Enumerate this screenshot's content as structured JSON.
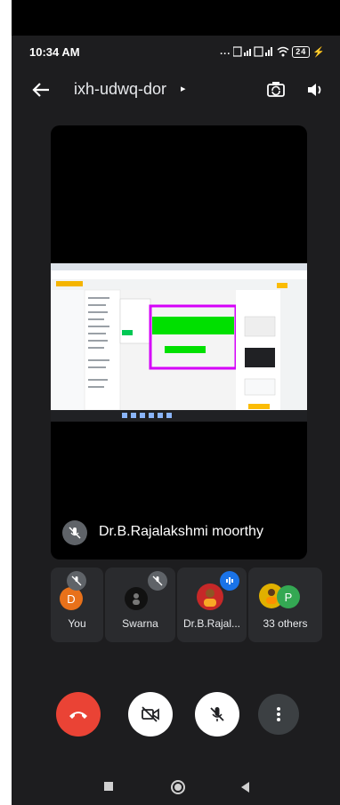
{
  "status": {
    "time": "10:34 AM",
    "signal": "...",
    "battery": "24"
  },
  "appbar": {
    "meeting_code": "ixh-udwq-dor",
    "caret": "▸"
  },
  "main_tile": {
    "speaker_name": "Dr.B.Rajalakshmi moorthy"
  },
  "participants": [
    {
      "label": "You",
      "initial": "D",
      "color": "#e8711a"
    },
    {
      "label": "Swarna"
    },
    {
      "label": "Dr.B.Rajal..."
    },
    {
      "label": "33 others",
      "initial": "P",
      "color": "#34a853"
    }
  ],
  "colors": {
    "background": "#1d1d1f",
    "tile": "#2a2b2e",
    "end_call": "#ea4335",
    "accent_blue": "#1a73e8"
  }
}
